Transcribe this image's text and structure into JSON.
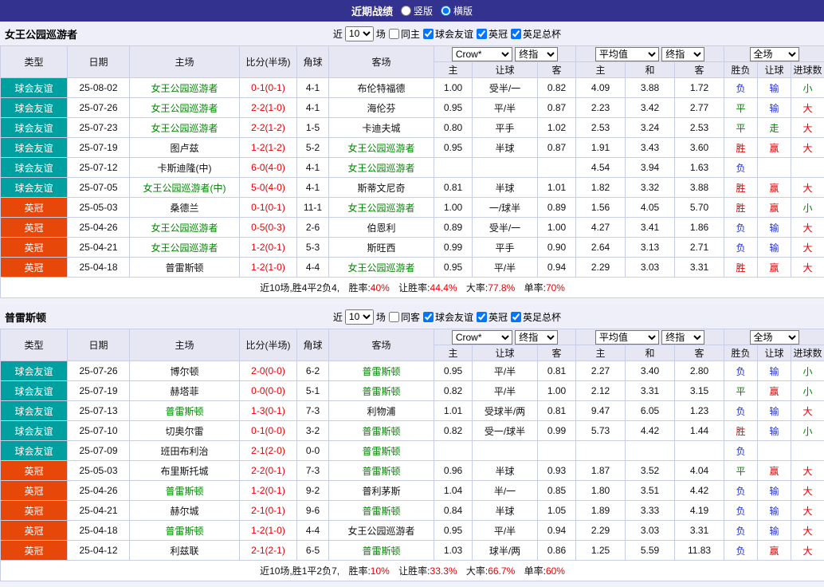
{
  "top_bar": {
    "title": "近期战绩",
    "vertical": "竖版",
    "horizontal": "横版",
    "vertical_checked": false,
    "horizontal_checked": true
  },
  "table_headers": {
    "type": "类型",
    "date": "日期",
    "home": "主场",
    "score": "比分(半场)",
    "corner": "角球",
    "away": "客场",
    "dropdowns": {
      "bookmaker": "Crow*",
      "final1": "终指",
      "average": "平均值",
      "final2": "终指",
      "fulltime": "全场"
    },
    "sub": {
      "home_odds": "主",
      "handicap": "让球",
      "away_odds": "客",
      "avg_home": "主",
      "avg_draw": "和",
      "avg_away": "客",
      "result": "胜负",
      "handicap_result": "让球",
      "goals": "进球数"
    }
  },
  "colors": {
    "league": {
      "球会友谊": "#00A0A0",
      "英冠": "#E8470A"
    },
    "outcome": {
      "胜": "#E60000",
      "平": "#008800",
      "负": "#2233CC",
      "赢": "#E60000",
      "走": "#008800",
      "输": "#2233CC",
      "大": "#E60000",
      "小": "#008800"
    },
    "highlight": "#008800",
    "score": "#E60000"
  },
  "sections": [
    {
      "team": "女王公园巡游者",
      "filter": {
        "near": "近",
        "count": "10",
        "games": "场",
        "same": "同主",
        "same_checked": false,
        "leagues": [
          "球会友谊",
          "英冠",
          "英足总杯"
        ],
        "leagues_checked": [
          true,
          true,
          true
        ]
      },
      "rows": [
        {
          "league": "球会友谊",
          "date": "25-08-02",
          "home": "女王公园巡游者",
          "score": "0-1(0-1)",
          "corner": "4-1",
          "away": "布伦特福德",
          "odds": [
            "1.00",
            "受半/一",
            "0.82"
          ],
          "avg": [
            "4.09",
            "3.88",
            "1.72"
          ],
          "result": "负",
          "hresult": "输",
          "goals": "小"
        },
        {
          "league": "球会友谊",
          "date": "25-07-26",
          "home": "女王公园巡游者",
          "score": "2-2(1-0)",
          "corner": "4-1",
          "away": "海伦芬",
          "odds": [
            "0.95",
            "平/半",
            "0.87"
          ],
          "avg": [
            "2.23",
            "3.42",
            "2.77"
          ],
          "result": "平",
          "hresult": "输",
          "goals": "大"
        },
        {
          "league": "球会友谊",
          "date": "25-07-23",
          "home": "女王公园巡游者",
          "score": "2-2(1-2)",
          "corner": "1-5",
          "away": "卡迪夫城",
          "odds": [
            "0.80",
            "平手",
            "1.02"
          ],
          "avg": [
            "2.53",
            "3.24",
            "2.53"
          ],
          "result": "平",
          "hresult": "走",
          "goals": "大"
        },
        {
          "league": "球会友谊",
          "date": "25-07-19",
          "home": "图卢兹",
          "score": "1-2(1-2)",
          "corner": "5-2",
          "away": "女王公园巡游者",
          "odds": [
            "0.95",
            "半球",
            "0.87"
          ],
          "avg": [
            "1.91",
            "3.43",
            "3.60"
          ],
          "result": "胜",
          "hresult": "赢",
          "goals": "大"
        },
        {
          "league": "球会友谊",
          "date": "25-07-12",
          "home": "卡斯迪隆(中)",
          "score": "6-0(4-0)",
          "corner": "4-1",
          "away": "女王公园巡游者",
          "odds": [
            "",
            "",
            ""
          ],
          "avg": [
            "4.54",
            "3.94",
            "1.63"
          ],
          "result": "负",
          "hresult": "",
          "goals": ""
        },
        {
          "league": "球会友谊",
          "date": "25-07-05",
          "home": "女王公园巡游者(中)",
          "score": "5-0(4-0)",
          "corner": "4-1",
          "away": "斯蒂文尼奇",
          "odds": [
            "0.81",
            "半球",
            "1.01"
          ],
          "avg": [
            "1.82",
            "3.32",
            "3.88"
          ],
          "result": "胜",
          "hresult": "赢",
          "goals": "大"
        },
        {
          "league": "英冠",
          "date": "25-05-03",
          "home": "桑德兰",
          "score": "0-1(0-1)",
          "corner": "11-1",
          "away": "女王公园巡游者",
          "odds": [
            "1.00",
            "一/球半",
            "0.89"
          ],
          "avg": [
            "1.56",
            "4.05",
            "5.70"
          ],
          "result": "胜",
          "hresult": "赢",
          "goals": "小"
        },
        {
          "league": "英冠",
          "date": "25-04-26",
          "home": "女王公园巡游者",
          "score": "0-5(0-3)",
          "corner": "2-6",
          "away": "伯恩利",
          "odds": [
            "0.89",
            "受半/一",
            "1.00"
          ],
          "avg": [
            "4.27",
            "3.41",
            "1.86"
          ],
          "result": "负",
          "hresult": "输",
          "goals": "大"
        },
        {
          "league": "英冠",
          "date": "25-04-21",
          "home": "女王公园巡游者",
          "score": "1-2(0-1)",
          "corner": "5-3",
          "away": "斯旺西",
          "odds": [
            "0.99",
            "平手",
            "0.90"
          ],
          "avg": [
            "2.64",
            "3.13",
            "2.71"
          ],
          "result": "负",
          "hresult": "输",
          "goals": "大"
        },
        {
          "league": "英冠",
          "date": "25-04-18",
          "home": "普雷斯顿",
          "score": "1-2(1-0)",
          "corner": "4-4",
          "away": "女王公园巡游者",
          "odds": [
            "0.95",
            "平/半",
            "0.94"
          ],
          "avg": [
            "2.29",
            "3.03",
            "3.31"
          ],
          "result": "胜",
          "hresult": "赢",
          "goals": "大"
        }
      ],
      "summary": {
        "prefix": "近10场,胜4平2负4,",
        "stats": [
          {
            "label": "胜率:",
            "value": "40%"
          },
          {
            "label": "让胜率:",
            "value": "44.4%"
          },
          {
            "label": "大率:",
            "value": "77.8%"
          },
          {
            "label": "单率:",
            "value": "70%"
          }
        ]
      }
    },
    {
      "team": "普雷斯顿",
      "filter": {
        "near": "近",
        "count": "10",
        "games": "场",
        "same": "同客",
        "same_checked": false,
        "leagues": [
          "球会友谊",
          "英冠",
          "英足总杯"
        ],
        "leagues_checked": [
          true,
          true,
          true
        ]
      },
      "rows": [
        {
          "league": "球会友谊",
          "date": "25-07-26",
          "home": "博尔顿",
          "score": "2-0(0-0)",
          "corner": "6-2",
          "away": "普雷斯顿",
          "odds": [
            "0.95",
            "平/半",
            "0.81"
          ],
          "avg": [
            "2.27",
            "3.40",
            "2.80"
          ],
          "result": "负",
          "hresult": "输",
          "goals": "小"
        },
        {
          "league": "球会友谊",
          "date": "25-07-19",
          "home": "赫塔菲",
          "score": "0-0(0-0)",
          "corner": "5-1",
          "away": "普雷斯顿",
          "odds": [
            "0.82",
            "平/半",
            "1.00"
          ],
          "avg": [
            "2.12",
            "3.31",
            "3.15"
          ],
          "result": "平",
          "hresult": "赢",
          "goals": "小"
        },
        {
          "league": "球会友谊",
          "date": "25-07-13",
          "home": "普雷斯顿",
          "score": "1-3(0-1)",
          "corner": "7-3",
          "away": "利物浦",
          "odds": [
            "1.01",
            "受球半/两",
            "0.81"
          ],
          "avg": [
            "9.47",
            "6.05",
            "1.23"
          ],
          "result": "负",
          "hresult": "输",
          "goals": "大"
        },
        {
          "league": "球会友谊",
          "date": "25-07-10",
          "home": "切奥尔雷",
          "score": "0-1(0-0)",
          "corner": "3-2",
          "away": "普雷斯顿",
          "odds": [
            "0.82",
            "受一/球半",
            "0.99"
          ],
          "avg": [
            "5.73",
            "4.42",
            "1.44"
          ],
          "result": "胜",
          "hresult": "输",
          "goals": "小"
        },
        {
          "league": "球会友谊",
          "date": "25-07-09",
          "home": "班田布利治",
          "score": "2-1(2-0)",
          "corner": "0-0",
          "away": "普雷斯顿",
          "odds": [
            "",
            "",
            ""
          ],
          "avg": [
            "",
            "",
            ""
          ],
          "result": "负",
          "hresult": "",
          "goals": ""
        },
        {
          "league": "英冠",
          "date": "25-05-03",
          "home": "布里斯托城",
          "score": "2-2(0-1)",
          "corner": "7-3",
          "away": "普雷斯顿",
          "odds": [
            "0.96",
            "半球",
            "0.93"
          ],
          "avg": [
            "1.87",
            "3.52",
            "4.04"
          ],
          "result": "平",
          "hresult": "赢",
          "goals": "大"
        },
        {
          "league": "英冠",
          "date": "25-04-26",
          "home": "普雷斯顿",
          "score": "1-2(0-1)",
          "corner": "9-2",
          "away": "普利茅斯",
          "odds": [
            "1.04",
            "半/一",
            "0.85"
          ],
          "avg": [
            "1.80",
            "3.51",
            "4.42"
          ],
          "result": "负",
          "hresult": "输",
          "goals": "大"
        },
        {
          "league": "英冠",
          "date": "25-04-21",
          "home": "赫尔城",
          "score": "2-1(0-1)",
          "corner": "9-6",
          "away": "普雷斯顿",
          "odds": [
            "0.84",
            "半球",
            "1.05"
          ],
          "avg": [
            "1.89",
            "3.33",
            "4.19"
          ],
          "result": "负",
          "hresult": "输",
          "goals": "大"
        },
        {
          "league": "英冠",
          "date": "25-04-18",
          "home": "普雷斯顿",
          "score": "1-2(1-0)",
          "corner": "4-4",
          "away": "女王公园巡游者",
          "odds": [
            "0.95",
            "平/半",
            "0.94"
          ],
          "avg": [
            "2.29",
            "3.03",
            "3.31"
          ],
          "result": "负",
          "hresult": "输",
          "goals": "大"
        },
        {
          "league": "英冠",
          "date": "25-04-12",
          "home": "利兹联",
          "score": "2-1(2-1)",
          "corner": "6-5",
          "away": "普雷斯顿",
          "odds": [
            "1.03",
            "球半/两",
            "0.86"
          ],
          "avg": [
            "1.25",
            "5.59",
            "11.83"
          ],
          "result": "负",
          "hresult": "赢",
          "goals": "大"
        }
      ],
      "summary": {
        "prefix": "近10场,胜1平2负7,",
        "stats": [
          {
            "label": "胜率:",
            "value": "10%"
          },
          {
            "label": "让胜率:",
            "value": "33.3%"
          },
          {
            "label": "大率:",
            "value": "66.7%"
          },
          {
            "label": "单率:",
            "value": "60%"
          }
        ]
      }
    }
  ]
}
